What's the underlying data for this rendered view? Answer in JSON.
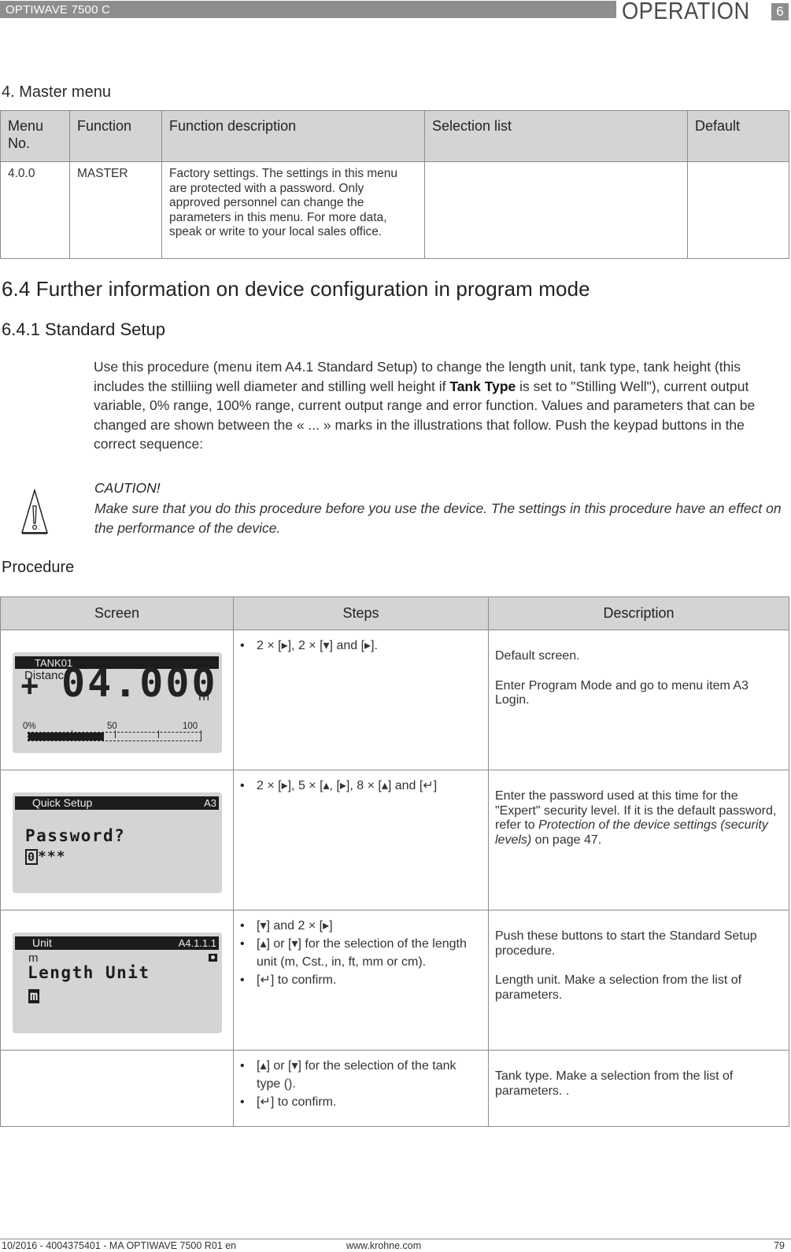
{
  "header": {
    "product": "OPTIWAVE 7500 C",
    "chapter_title": "OPERATION",
    "chapter_number": "6"
  },
  "master_menu": {
    "title": "4. Master menu",
    "columns": [
      "Menu No.",
      "Function",
      "Function description",
      "Selection list",
      "Default"
    ],
    "rows": [
      {
        "menu_no": "4.0.0",
        "function": "MASTER",
        "description": "Factory settings. The settings in this menu are protected with a password. Only approved personnel can change the parameters in this menu. For more data, speak or write to your local sales office.",
        "selection_list": "",
        "default": ""
      }
    ]
  },
  "section": {
    "title": "6.4  Further information on device configuration in program mode",
    "subsection_title": "6.4.1  Standard Setup",
    "intro_part1": "Use this procedure (menu item A4.1 Standard Setup) to change the length unit, tank type, tank height (this includes the stilliing well diameter and stilling well height if ",
    "intro_bold": "Tank Type",
    "intro_part2": " is set to \"Stilling Well\"), current output variable, 0% range, 100% range, current output range and error function. Values and parameters that can be changed are shown between the « ... » marks in the illustrations that follow. Push the keypad buttons in the correct sequence:"
  },
  "caution": {
    "icon": "warning-triangle-icon",
    "title": "CAUTION!",
    "text": "Make sure that you do this procedure before you use the device. The settings in this procedure have an effect on the performance of the device."
  },
  "procedure": {
    "title": "Procedure",
    "columns": [
      "Screen",
      "Steps",
      "Description"
    ],
    "keys": {
      "right": "▸",
      "down": "▾",
      "up": "▴",
      "enter": "↵"
    },
    "rows": [
      {
        "screen": {
          "title": "TANK01",
          "label": "Distance",
          "sign": "+",
          "value": "04.000",
          "unit": "m",
          "scale_labels": [
            "0%",
            "50",
            "100"
          ],
          "bar_fill_percent": 44
        },
        "steps": [
          "2 × [▸], 2 × [▾] and [▸]."
        ],
        "description": [
          "Default screen.",
          "Enter Program Mode and go to menu item A3 Login."
        ]
      },
      {
        "screen": {
          "title": "Quick Setup",
          "code": "A3",
          "prompt": "Password?",
          "cursor_digit": "0",
          "masked": "***"
        },
        "steps": [
          "2 × [▸], 5 × [▴, [▸], 8 × [▴] and [↵]"
        ],
        "description_part1": "Enter the password used at this time for the \"Expert\" security level. If it is the default password, refer to ",
        "description_link": "Protection of the device settings (security levels)",
        "description_part2": " on page 47."
      },
      {
        "screen": {
          "title": "Unit",
          "code": "A4.1.1.1",
          "current": "m",
          "prompt": "Length Unit",
          "selected": "m"
        },
        "steps": [
          "[▾] and 2 × [▸]",
          "[▴] or [▾] for the selection of the length unit (m, Cst., in, ft, mm or cm).",
          "[↵] to confirm."
        ],
        "description": [
          "Push these buttons to start the Standard Setup procedure.",
          "Length unit. Make a selection from the list of parameters."
        ]
      },
      {
        "screen": null,
        "steps": [
          "[▴] or [▾] for the selection of the tank type ().",
          "[↵] to confirm."
        ],
        "description": [
          "Tank type. Make a selection from the list of parameters. ."
        ]
      }
    ]
  },
  "footer": {
    "doc_ref": "10/2016 - 4004375401 - MA OPTIWAVE 7500 R01 en",
    "website": "www.krohne.com",
    "page_number": "79"
  }
}
